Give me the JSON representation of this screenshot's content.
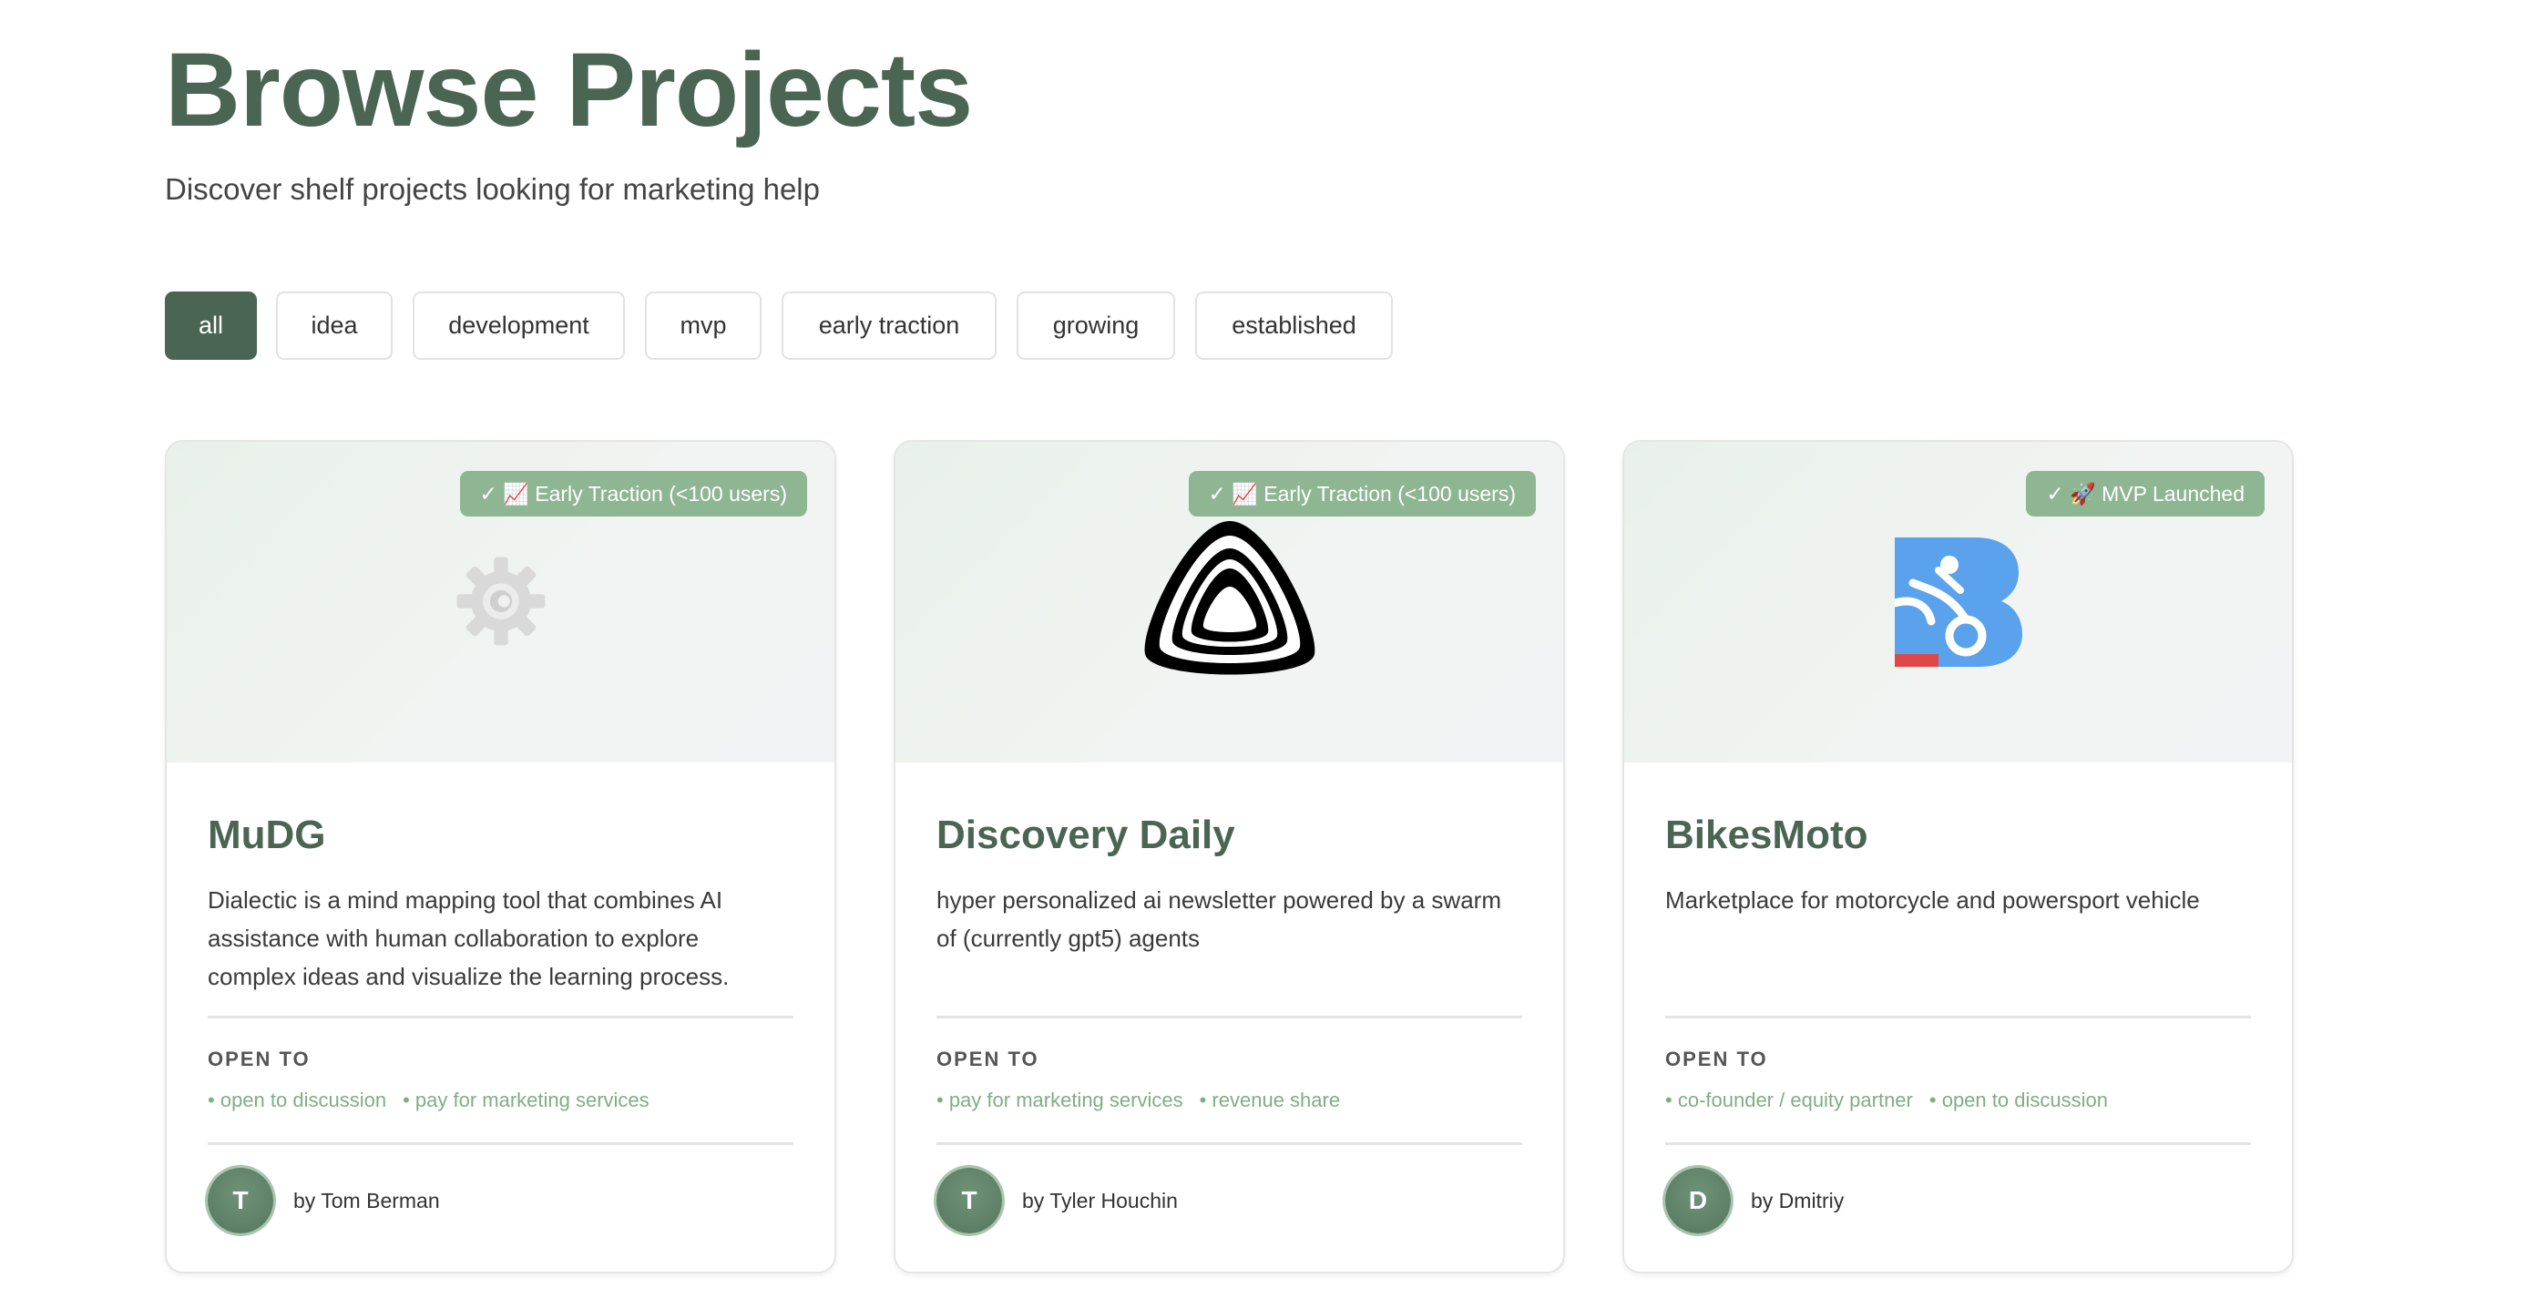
{
  "header": {
    "title": "Browse Projects",
    "subtitle": "Discover shelf projects looking for marketing help"
  },
  "filters": [
    {
      "label": "all",
      "active": true
    },
    {
      "label": "idea",
      "active": false
    },
    {
      "label": "development",
      "active": false
    },
    {
      "label": "mvp",
      "active": false
    },
    {
      "label": "early traction",
      "active": false
    },
    {
      "label": "growing",
      "active": false
    },
    {
      "label": "established",
      "active": false
    }
  ],
  "open_to_label": "OPEN TO",
  "projects": [
    {
      "badge": "✓ 📈 Early Traction (<100 users)",
      "logo": "gear-icon",
      "title": "MuDG",
      "description": "Dialectic is a mind mapping tool that combines AI assistance with human collaboration to explore complex ideas and visualize the learning process.",
      "open_to": [
        "open to discussion",
        "pay for marketing services"
      ],
      "author_initial": "T",
      "author": "by Tom Berman"
    },
    {
      "badge": "✓ 📈 Early Traction (<100 users)",
      "logo": "triangle-swirl-logo",
      "title": "Discovery Daily",
      "description": "hyper personalized ai newsletter powered by a swarm of (currently gpt5) agents",
      "open_to": [
        "pay for marketing services",
        "revenue share"
      ],
      "author_initial": "T",
      "author": "by Tyler Houchin"
    },
    {
      "badge": "✓ 🚀 MVP Launched",
      "logo": "bikesmoto-b-logo",
      "title": "BikesMoto",
      "description": "Marketplace for motorcycle and powersport vehicle",
      "open_to": [
        "co-founder / equity partner",
        "open to discussion"
      ],
      "author_initial": "D",
      "author": "by Dmitriy"
    }
  ],
  "colors": {
    "brand": "#4a6553",
    "badge": "#8fb692",
    "tag": "#7fae84",
    "logo_blue": "#5aa2ec",
    "logo_red": "#e04848"
  }
}
